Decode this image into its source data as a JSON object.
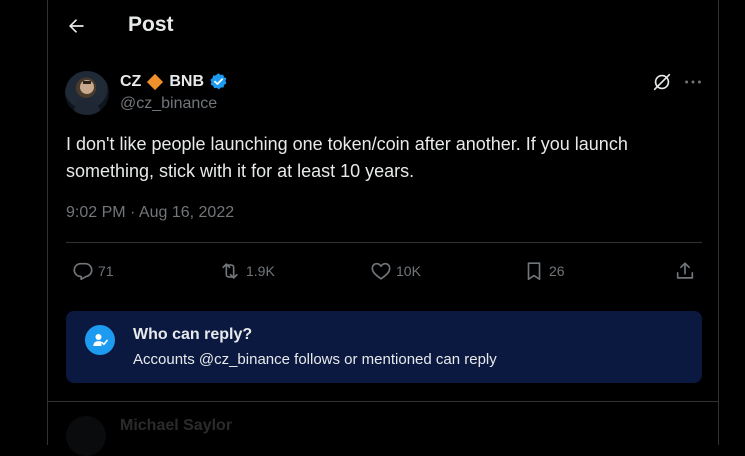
{
  "header": {
    "title": "Post",
    "back_icon": "arrow-left-icon"
  },
  "author": {
    "name_prefix": "CZ",
    "name_suffix": "BNB",
    "handle": "@cz_binance",
    "verified": true,
    "diamond_color": "#f0902b",
    "verified_color": "#1d9bf0"
  },
  "tweet": {
    "text": "I don't like people launching one token/coin after another. If you launch something, stick with it for at least 10 years.",
    "timestamp": "9:02 PM · Aug 16, 2022"
  },
  "actions": {
    "replies": "71",
    "reposts": "1.9K",
    "likes": "10K",
    "bookmarks": "26"
  },
  "reply_restriction": {
    "title": "Who can reply?",
    "description": "Accounts @cz_binance follows or mentioned can reply",
    "accent": "#1d9bf0",
    "background": "#0b1940"
  },
  "next_item": {
    "name": "Michael Saylor"
  }
}
